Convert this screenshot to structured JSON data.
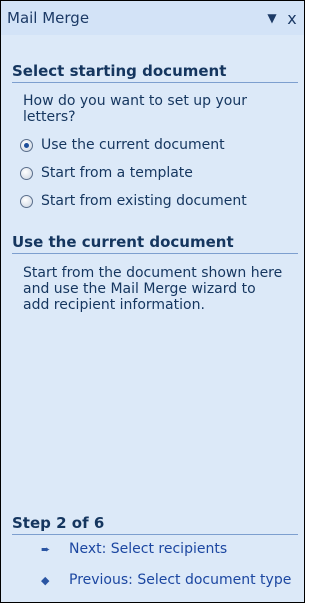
{
  "pane": {
    "title": "Mail Merge",
    "menu_icon": "▼",
    "close_icon": "x"
  },
  "select_section": {
    "heading": "Select starting document",
    "question": "How do you want to set up your letters?",
    "options": [
      {
        "label": "Use the current document",
        "checked": true
      },
      {
        "label": "Start from a template",
        "checked": false
      },
      {
        "label": "Start from existing document",
        "checked": false
      }
    ]
  },
  "use_section": {
    "heading": "Use the current document",
    "description": "Start from the document shown here and use the Mail Merge wizard to add recipient information."
  },
  "step": {
    "heading": "Step 2 of 6",
    "next_label": "Next: Select recipients",
    "previous_label": "Previous: Select document type",
    "next_icon": "➨",
    "previous_icon": "◆"
  }
}
